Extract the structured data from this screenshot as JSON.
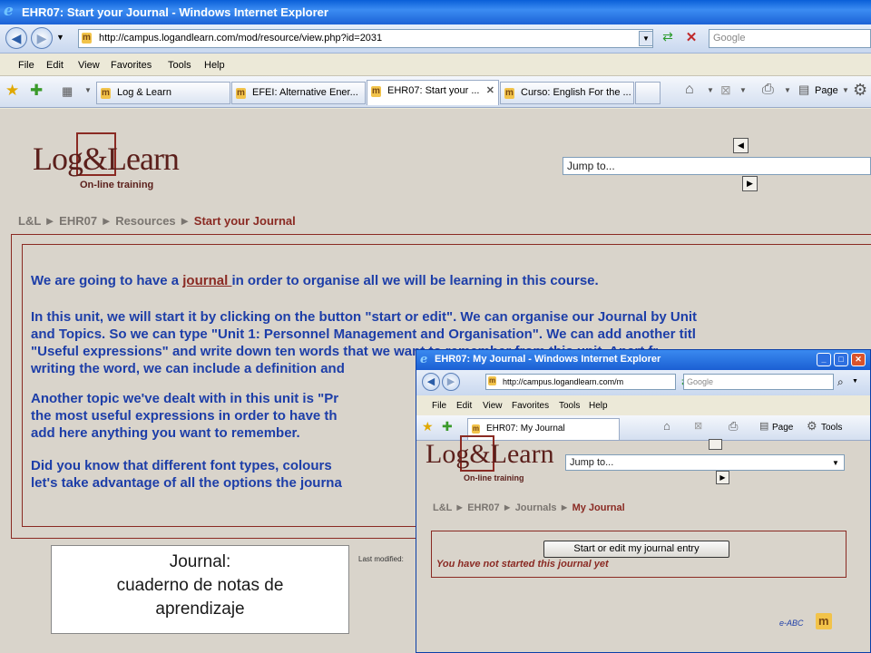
{
  "main_window": {
    "title": "EHR07: Start your Journal - Windows Internet Explorer",
    "address": "http://campus.logandlearn.com/mod/resource/view.php?id=2031",
    "search_placeholder": "Google",
    "menu": [
      "File",
      "Edit",
      "View",
      "Favorites",
      "Tools",
      "Help"
    ],
    "tabs": [
      {
        "label": "Log & Learn"
      },
      {
        "label": "EFEI: Alternative Ener..."
      },
      {
        "label": "EHR07: Start your ...",
        "active": true
      },
      {
        "label": "Curso: English For the ..."
      }
    ],
    "toolbar": {
      "page_label": "Page"
    }
  },
  "site": {
    "logo_text": "Log&Learn",
    "logo_subtitle": "On-line training",
    "breadcrumb": [
      "L&L",
      "EHR07",
      "Resources",
      "Start your Journal"
    ],
    "jump_placeholder": "Jump to...",
    "nav_prev": "◀",
    "nav_next": "▶"
  },
  "content": {
    "para1_a": "We are going to have a ",
    "para1_link": "journal ",
    "para1_b": "in order to organise all we will be learning in this course.",
    "para2_lines": [
      "In this unit, we will start it by clicking on the button \"start or edit\". We can organise our Journal by Unit",
      "and Topics. So we can type \"Unit 1: Personnel Management and Organisation\". We can add another titl",
      "\"Useful expressions\" and write down ten words that we want to remember from this unit. Apart fr",
      "writing the word, we can include a definition and"
    ],
    "para3_lines": [
      "Another topic we've dealt with in this unit is \"Pr",
      "the most useful expressions in order to have th",
      "add here anything you want to remember."
    ],
    "para4_lines": [
      "Did you know that different font types, colours",
      "let's take advantage of all the options the journa"
    ],
    "last_modified": "Last modified:"
  },
  "caption": {
    "line1": "Journal:",
    "line2": "cuaderno de notas de",
    "line3": "aprendizaje"
  },
  "popup": {
    "title": "EHR07: My Journal - Windows Internet Explorer",
    "address": "http://campus.logandlearn.com/m",
    "search_placeholder": "Google",
    "menu": [
      "File",
      "Edit",
      "View",
      "Favorites",
      "Tools",
      "Help"
    ],
    "tab_label": "EHR07: My Journal",
    "page_label": "Page",
    "tools_label": "Tools",
    "jump_placeholder": "Jump to...",
    "breadcrumb": [
      "L&L",
      "EHR07",
      "Journals",
      "My Journal"
    ],
    "start_button": "Start or edit my journal entry",
    "not_started": "You have not started this journal yet",
    "footer_brand": "e-ABC"
  },
  "colors": {
    "accent_blue": "#1d3ea8",
    "brand_red": "#8a2a23",
    "page_bg": "#d9d4cb"
  }
}
